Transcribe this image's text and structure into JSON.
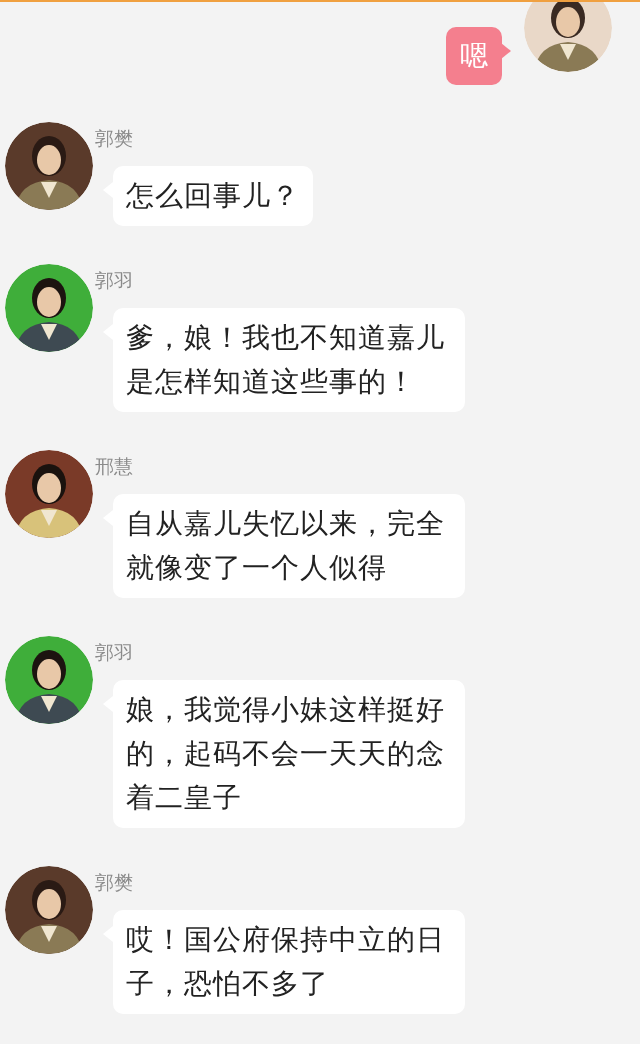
{
  "messages": [
    {
      "kind": "outgoing",
      "text": "嗯"
    },
    {
      "kind": "incoming",
      "sender": "郭樊",
      "text": "怎么回事儿？"
    },
    {
      "kind": "incoming",
      "sender": "郭羽",
      "text": "爹，娘！我也不知道嘉儿是怎样知道这些事的！"
    },
    {
      "kind": "incoming",
      "sender": "邢慧",
      "text": "自从嘉儿失忆以来，完全就像变了一个人似得"
    },
    {
      "kind": "incoming",
      "sender": "郭羽",
      "text": "娘，我觉得小妹这样挺好的，起码不会一天天的念着二皇子"
    },
    {
      "kind": "incoming",
      "sender": "郭樊",
      "text": "哎！国公府保持中立的日子，恐怕不多了"
    }
  ]
}
